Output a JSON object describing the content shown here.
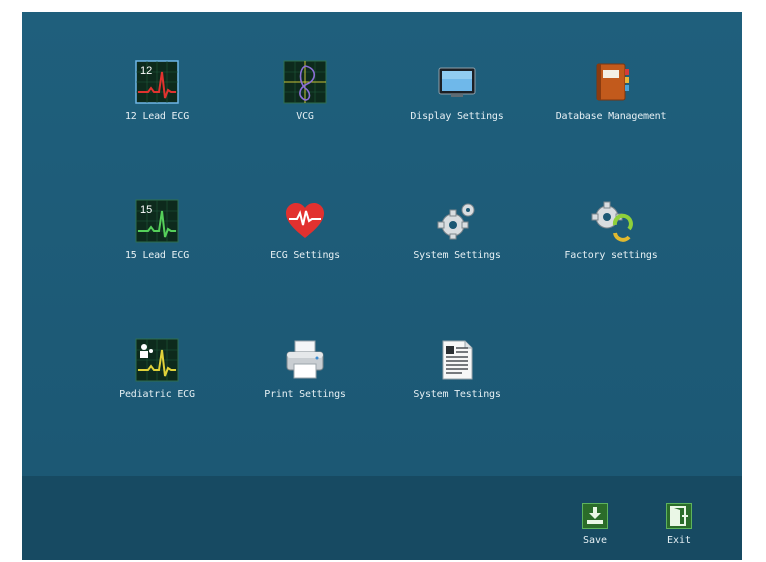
{
  "menu": {
    "items": [
      {
        "label": "12 Lead ECG",
        "icon": "ecg-12-lead-icon"
      },
      {
        "label": "VCG",
        "icon": "vcg-icon"
      },
      {
        "label": "Display Settings",
        "icon": "monitor-icon"
      },
      {
        "label": "Database Management",
        "icon": "address-book-icon"
      },
      {
        "label": "15 Lead ECG",
        "icon": "ecg-15-lead-icon"
      },
      {
        "label": "ECG Settings",
        "icon": "heart-icon"
      },
      {
        "label": "System Settings",
        "icon": "gears-icon"
      },
      {
        "label": "Factory settings",
        "icon": "gear-refresh-icon"
      },
      {
        "label": "Pediatric ECG",
        "icon": "pediatric-ecg-icon"
      },
      {
        "label": "Print Settings",
        "icon": "printer-icon"
      },
      {
        "label": "System Testings",
        "icon": "document-icon"
      }
    ],
    "ecg_numbers": {
      "lead12": "12",
      "lead15": "15"
    }
  },
  "footer": {
    "save_label": "Save",
    "exit_label": "Exit"
  },
  "colors": {
    "background": "#1d5a76",
    "footer": "#174a62",
    "text": "#e6f0f4"
  }
}
